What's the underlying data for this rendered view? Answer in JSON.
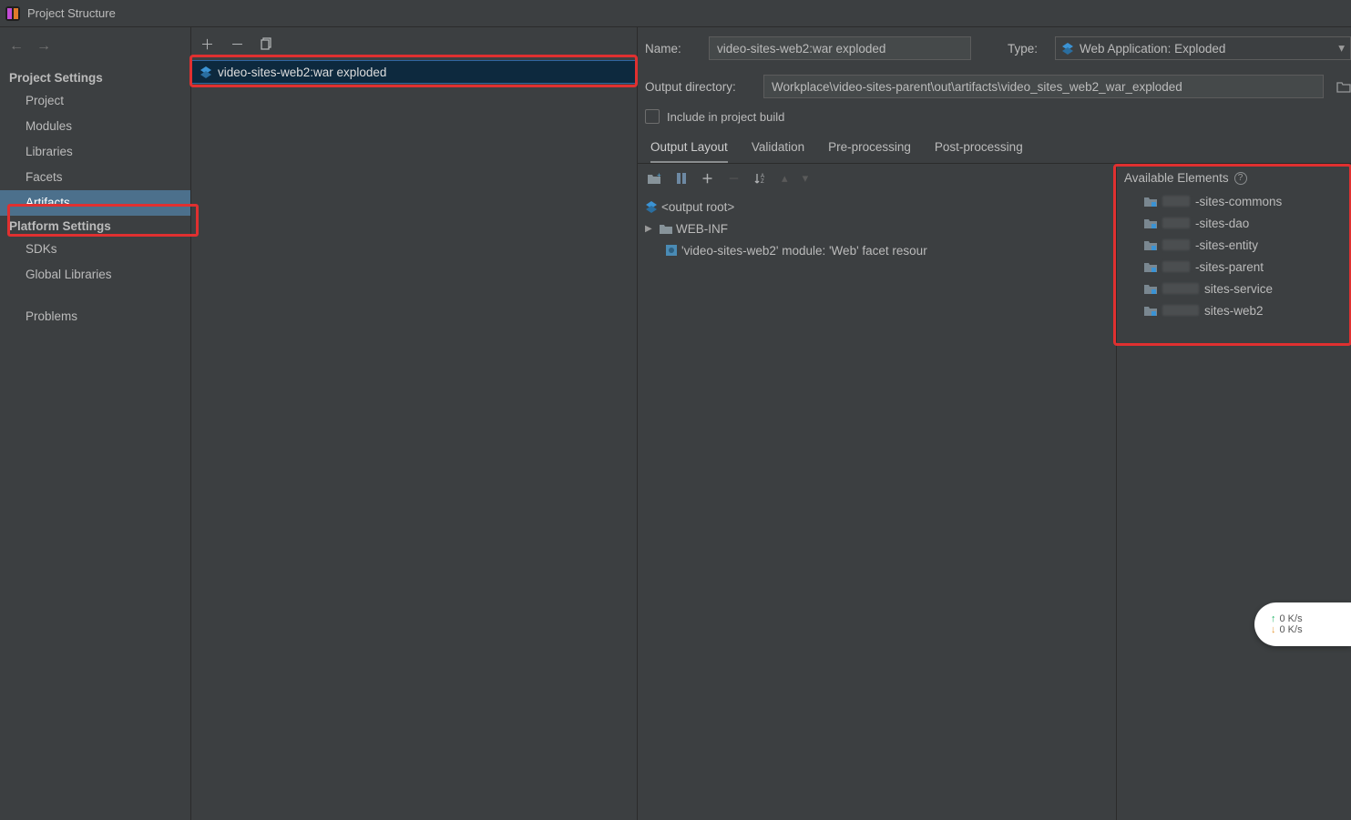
{
  "title": "Project Structure",
  "sidebar": {
    "section_project": "Project Settings",
    "items_project": [
      "Project",
      "Modules",
      "Libraries",
      "Facets",
      "Artifacts"
    ],
    "section_platform": "Platform Settings",
    "items_platform": [
      "SDKs",
      "Global Libraries"
    ],
    "items_other": [
      "Problems"
    ]
  },
  "artifact_list": {
    "items": [
      {
        "label": "video-sites-web2:war exploded"
      }
    ]
  },
  "editor": {
    "name_label": "Name:",
    "name_value": "video-sites-web2:war exploded",
    "type_label": "Type:",
    "type_value": "Web Application: Exploded",
    "outdir_label": "Output directory:",
    "outdir_value": "Workplace\\video-sites-parent\\out\\artifacts\\video_sites_web2_war_exploded",
    "include_build_label": "Include in project build",
    "tabs": [
      "Output Layout",
      "Validation",
      "Pre-processing",
      "Post-processing"
    ],
    "tree": {
      "root": "<output root>",
      "webinf": "WEB-INF",
      "facet": "'video-sites-web2' module: 'Web' facet resour"
    },
    "available_header": "Available Elements",
    "available": [
      "-sites-commons",
      "-sites-dao",
      "-sites-entity",
      "-sites-parent",
      "sites-service",
      "sites-web2"
    ]
  },
  "netspeed": {
    "up": "0  K/s",
    "down": "0  K/s"
  }
}
